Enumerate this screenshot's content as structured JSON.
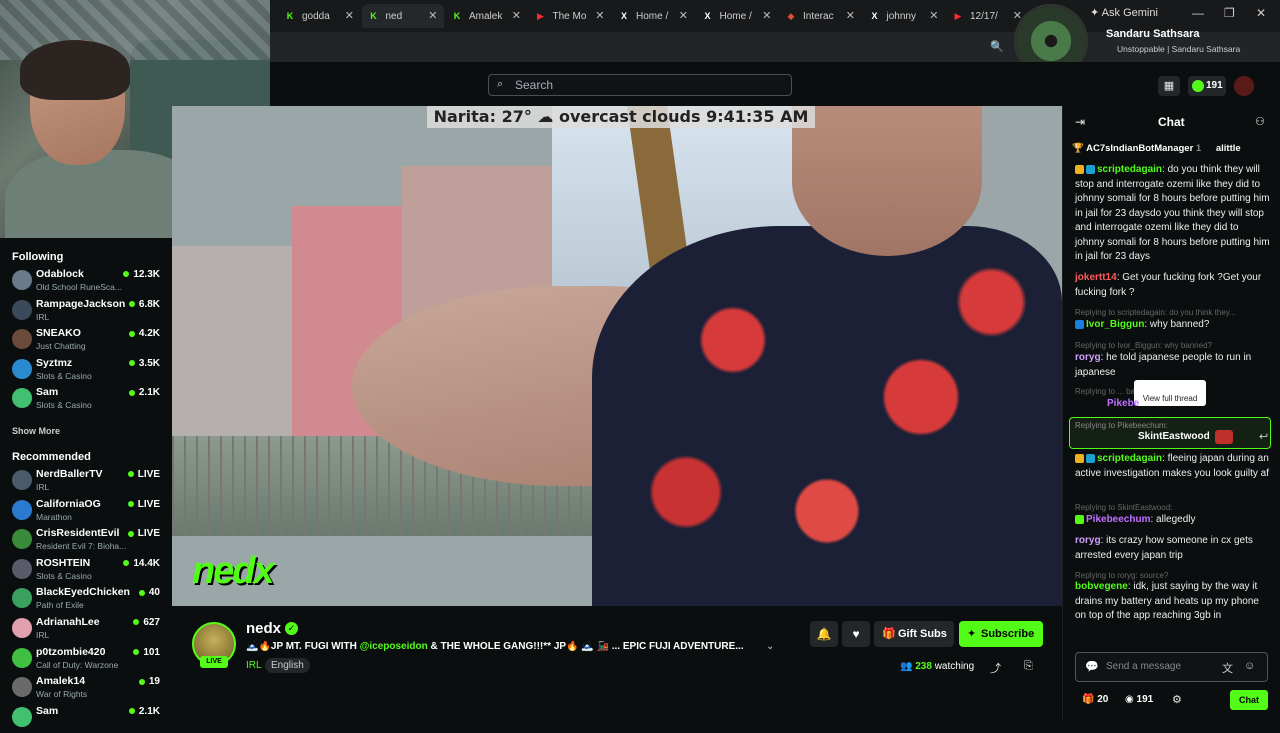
{
  "browser": {
    "tabs": [
      {
        "label": "godda",
        "fav": "K"
      },
      {
        "label": "ned",
        "fav": "K"
      },
      {
        "label": "Amalek",
        "fav": "K"
      },
      {
        "label": "The Mo",
        "fav": "▶"
      },
      {
        "label": "Home /",
        "fav": "X"
      },
      {
        "label": "Home /",
        "fav": "X"
      },
      {
        "label": "Interac",
        "fav": "◆"
      },
      {
        "label": "johnny",
        "fav": "X"
      },
      {
        "label": "12/17/",
        "fav": "▶"
      }
    ],
    "gemini_label": "Ask Gemini"
  },
  "profile": {
    "name": "Sandaru Sathsara",
    "sub": "Unstoppable | Sandaru Sathsara"
  },
  "header": {
    "search_placeholder": "Search",
    "coins": "191"
  },
  "sidebar": {
    "following_title": "Following",
    "following": [
      {
        "name": "Odablock",
        "cat": "Old School RuneSca...",
        "viewers": "12.3K",
        "color": "#6a7a8a"
      },
      {
        "name": "RampageJackson",
        "cat": "IRL",
        "viewers": "6.8K",
        "color": "#3a4a5a"
      },
      {
        "name": "SNEAKO",
        "cat": "Just Chatting",
        "viewers": "4.2K",
        "color": "#6a4a3a"
      },
      {
        "name": "Syztmz",
        "cat": "Slots & Casino",
        "viewers": "3.5K",
        "color": "#2a8ad0"
      },
      {
        "name": "Sam",
        "cat": "Slots & Casino",
        "viewers": "2.1K",
        "color": "#40c070"
      }
    ],
    "show_more": "Show More",
    "recommended_title": "Recommended",
    "recommended": [
      {
        "name": "NerdBallerTV",
        "cat": "IRL",
        "viewers": "LIVE",
        "color": "#4a5a6a"
      },
      {
        "name": "CaliforniaOG",
        "cat": "Marathon",
        "viewers": "LIVE",
        "color": "#2a7ad0"
      },
      {
        "name": "CrisResidentEvil",
        "cat": "Resident Evil 7: Bioha...",
        "viewers": "LIVE",
        "color": "#3a8a3a"
      },
      {
        "name": "ROSHTEIN",
        "cat": "Slots & Casino",
        "viewers": "14.4K",
        "color": "#5a5a6a"
      },
      {
        "name": "BlackEyedChicken",
        "cat": "Path of Exile",
        "viewers": "40",
        "color": "#3aa060"
      },
      {
        "name": "AdrianahLee",
        "cat": "IRL",
        "viewers": "627",
        "color": "#e0a0b0"
      },
      {
        "name": "p0tzombie420",
        "cat": "Call of Duty: Warzone",
        "viewers": "101",
        "color": "#40c040"
      },
      {
        "name": "Amalek14",
        "cat": "War of Rights",
        "viewers": "19",
        "color": "#6a6a6a"
      },
      {
        "name": "Sam",
        "cat": "",
        "viewers": "2.1K",
        "color": "#40c070"
      }
    ]
  },
  "video": {
    "overlay": "Narita: 27° ☁ overcast clouds 9:41:35 AM",
    "logo": "nedx"
  },
  "stream": {
    "name": "nedx",
    "live": "LIVE",
    "title_prefix": "🗻🔥JP MT. FUGI WITH ",
    "title_mention": "@iceposeidon",
    "title_suffix": " & THE WHOLE GANG!!!** JP🔥 🗻 🚂 ... EPIC FUJI ADVENTURE...",
    "category": "IRL",
    "language": "English",
    "gift_subs": "Gift Subs",
    "subscribe": "Subscribe",
    "watching_count": "238",
    "watching_label": "watching"
  },
  "chat": {
    "title": "Chat",
    "pinned_user": "AC7sIndianBotManager",
    "pinned_user2": "alittle",
    "messages": [
      {
        "user": "scriptedagain",
        "color": "#53fc18",
        "text": "do you think they will stop and interrogate ozemi like they did to johnny somali for 8 hours before putting him in jail for 23 daysdo you think they will stop and interrogate ozemi like they did to johnny somali for 8 hours before putting him in jail for 23 days"
      },
      {
        "user": "jokertt14",
        "color": "#ff5a5a",
        "text": "Get your fucking fork ?Get your fucking fork ?"
      },
      {
        "user": "Ivor_Biggun",
        "color": "#53fc18",
        "text": "why banned?"
      },
      {
        "user": "roryg",
        "color": "#d0a0ff",
        "text": "he told japanese people to run in japanese"
      },
      {
        "user": "SkintEastwood",
        "color": "#ffffff",
        "text": ""
      },
      {
        "user": "scriptedagain",
        "color": "#53fc18",
        "text": "fleeing japan during an active investigation makes you look guilty af"
      },
      {
        "user": "Pikebeechum",
        "color": "#c070ff",
        "text": "allegedly"
      },
      {
        "user": "roryg",
        "color": "#d0a0ff",
        "text": "its crazy how someone in cx gets arrested every japan trip"
      },
      {
        "user": "bobvegene",
        "color": "#53fc18",
        "text": "idk, just saying by the way it drains my battery and heats up my phone on top of the app reaching 3gb in"
      }
    ],
    "replies": [
      "Replying to scriptedagain: do you think they...",
      "Replying to Ivor_Biggun: why banned?",
      "Replying to ... banned?",
      "Replying to Pikebeechum:",
      "Replying to SkintEastwood:",
      "Replying to roryg: source?"
    ],
    "partial_user": "Pikebe",
    "tooltip": "View full thread",
    "input_placeholder": "Send a message",
    "bottom_count1": "20",
    "bottom_count2": "191",
    "send_label": "Chat"
  }
}
